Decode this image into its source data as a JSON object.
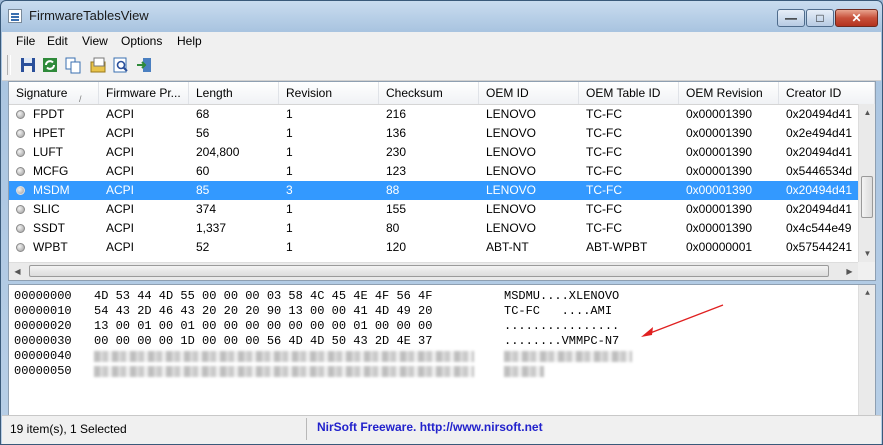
{
  "window": {
    "title": "FirmwareTablesView"
  },
  "controls": {
    "minimize": "—",
    "maximize": "□",
    "close": "✕"
  },
  "menu": [
    "File",
    "Edit",
    "View",
    "Options",
    "Help"
  ],
  "toolbar": {
    "icons": [
      "save-icon",
      "refresh-icon",
      "copy-icon",
      "properties-icon",
      "find-icon",
      "exit-icon"
    ]
  },
  "table": {
    "columns": [
      "Signature",
      "Firmware Pr...",
      "Length",
      "Revision",
      "Checksum",
      "OEM ID",
      "OEM Table ID",
      "OEM Revision",
      "Creator ID"
    ],
    "sort_indicator": "/",
    "rows": [
      [
        "FPDT",
        "ACPI",
        "68",
        "1",
        "216",
        "LENOVO",
        "TC-FC",
        "0x00001390",
        "0x20494d41"
      ],
      [
        "HPET",
        "ACPI",
        "56",
        "1",
        "136",
        "LENOVO",
        "TC-FC",
        "0x00001390",
        "0x2e494d41"
      ],
      [
        "LUFT",
        "ACPI",
        "204,800",
        "1",
        "230",
        "LENOVO",
        "TC-FC",
        "0x00001390",
        "0x20494d41"
      ],
      [
        "MCFG",
        "ACPI",
        "60",
        "1",
        "123",
        "LENOVO",
        "TC-FC",
        "0x00001390",
        "0x5446534d"
      ],
      [
        "MSDM",
        "ACPI",
        "85",
        "3",
        "88",
        "LENOVO",
        "TC-FC",
        "0x00001390",
        "0x20494d41"
      ],
      [
        "SLIC",
        "ACPI",
        "374",
        "1",
        "155",
        "LENOVO",
        "TC-FC",
        "0x00001390",
        "0x20494d41"
      ],
      [
        "SSDT",
        "ACPI",
        "1,337",
        "1",
        "80",
        "LENOVO",
        "TC-FC",
        "0x00001390",
        "0x4c544e49"
      ],
      [
        "WPBT",
        "ACPI",
        "52",
        "1",
        "120",
        "ABT-NT",
        "ABT-WPBT",
        "0x00000001",
        "0x57544241"
      ]
    ],
    "selected_index": 4
  },
  "hex": {
    "rows": [
      {
        "addr": "00000000",
        "bytes": "4D 53 44 4D 55 00 00 00 03 58 4C 45 4E 4F 56 4F",
        "ascii": "MSDMU....XLENOVO"
      },
      {
        "addr": "00000010",
        "bytes": "54 43 2D 46 43 20 20 20 90 13 00 00 41 4D 49 20",
        "ascii": "TC-FC   ....AMI"
      },
      {
        "addr": "00000020",
        "bytes": "13 00 01 00 01 00 00 00 00 00 00 00 01 00 00 00",
        "ascii": "................"
      },
      {
        "addr": "00000030",
        "bytes": "00 00 00 00 1D 00 00 00 56 4D 4D 50 43 2D 4E 37",
        "ascii": "........VMMPC-N7"
      },
      {
        "addr": "00000040",
        "bytes": "",
        "ascii": ""
      },
      {
        "addr": "00000050",
        "bytes": "",
        "ascii": ""
      }
    ]
  },
  "status": {
    "count": "19 item(s), 1 Selected",
    "link": "NirSoft Freeware.  http://www.nirsoft.net"
  },
  "colors": {
    "selection": "#3399ff",
    "annotation_arrow": "#e02020",
    "link": "#2222cc"
  }
}
